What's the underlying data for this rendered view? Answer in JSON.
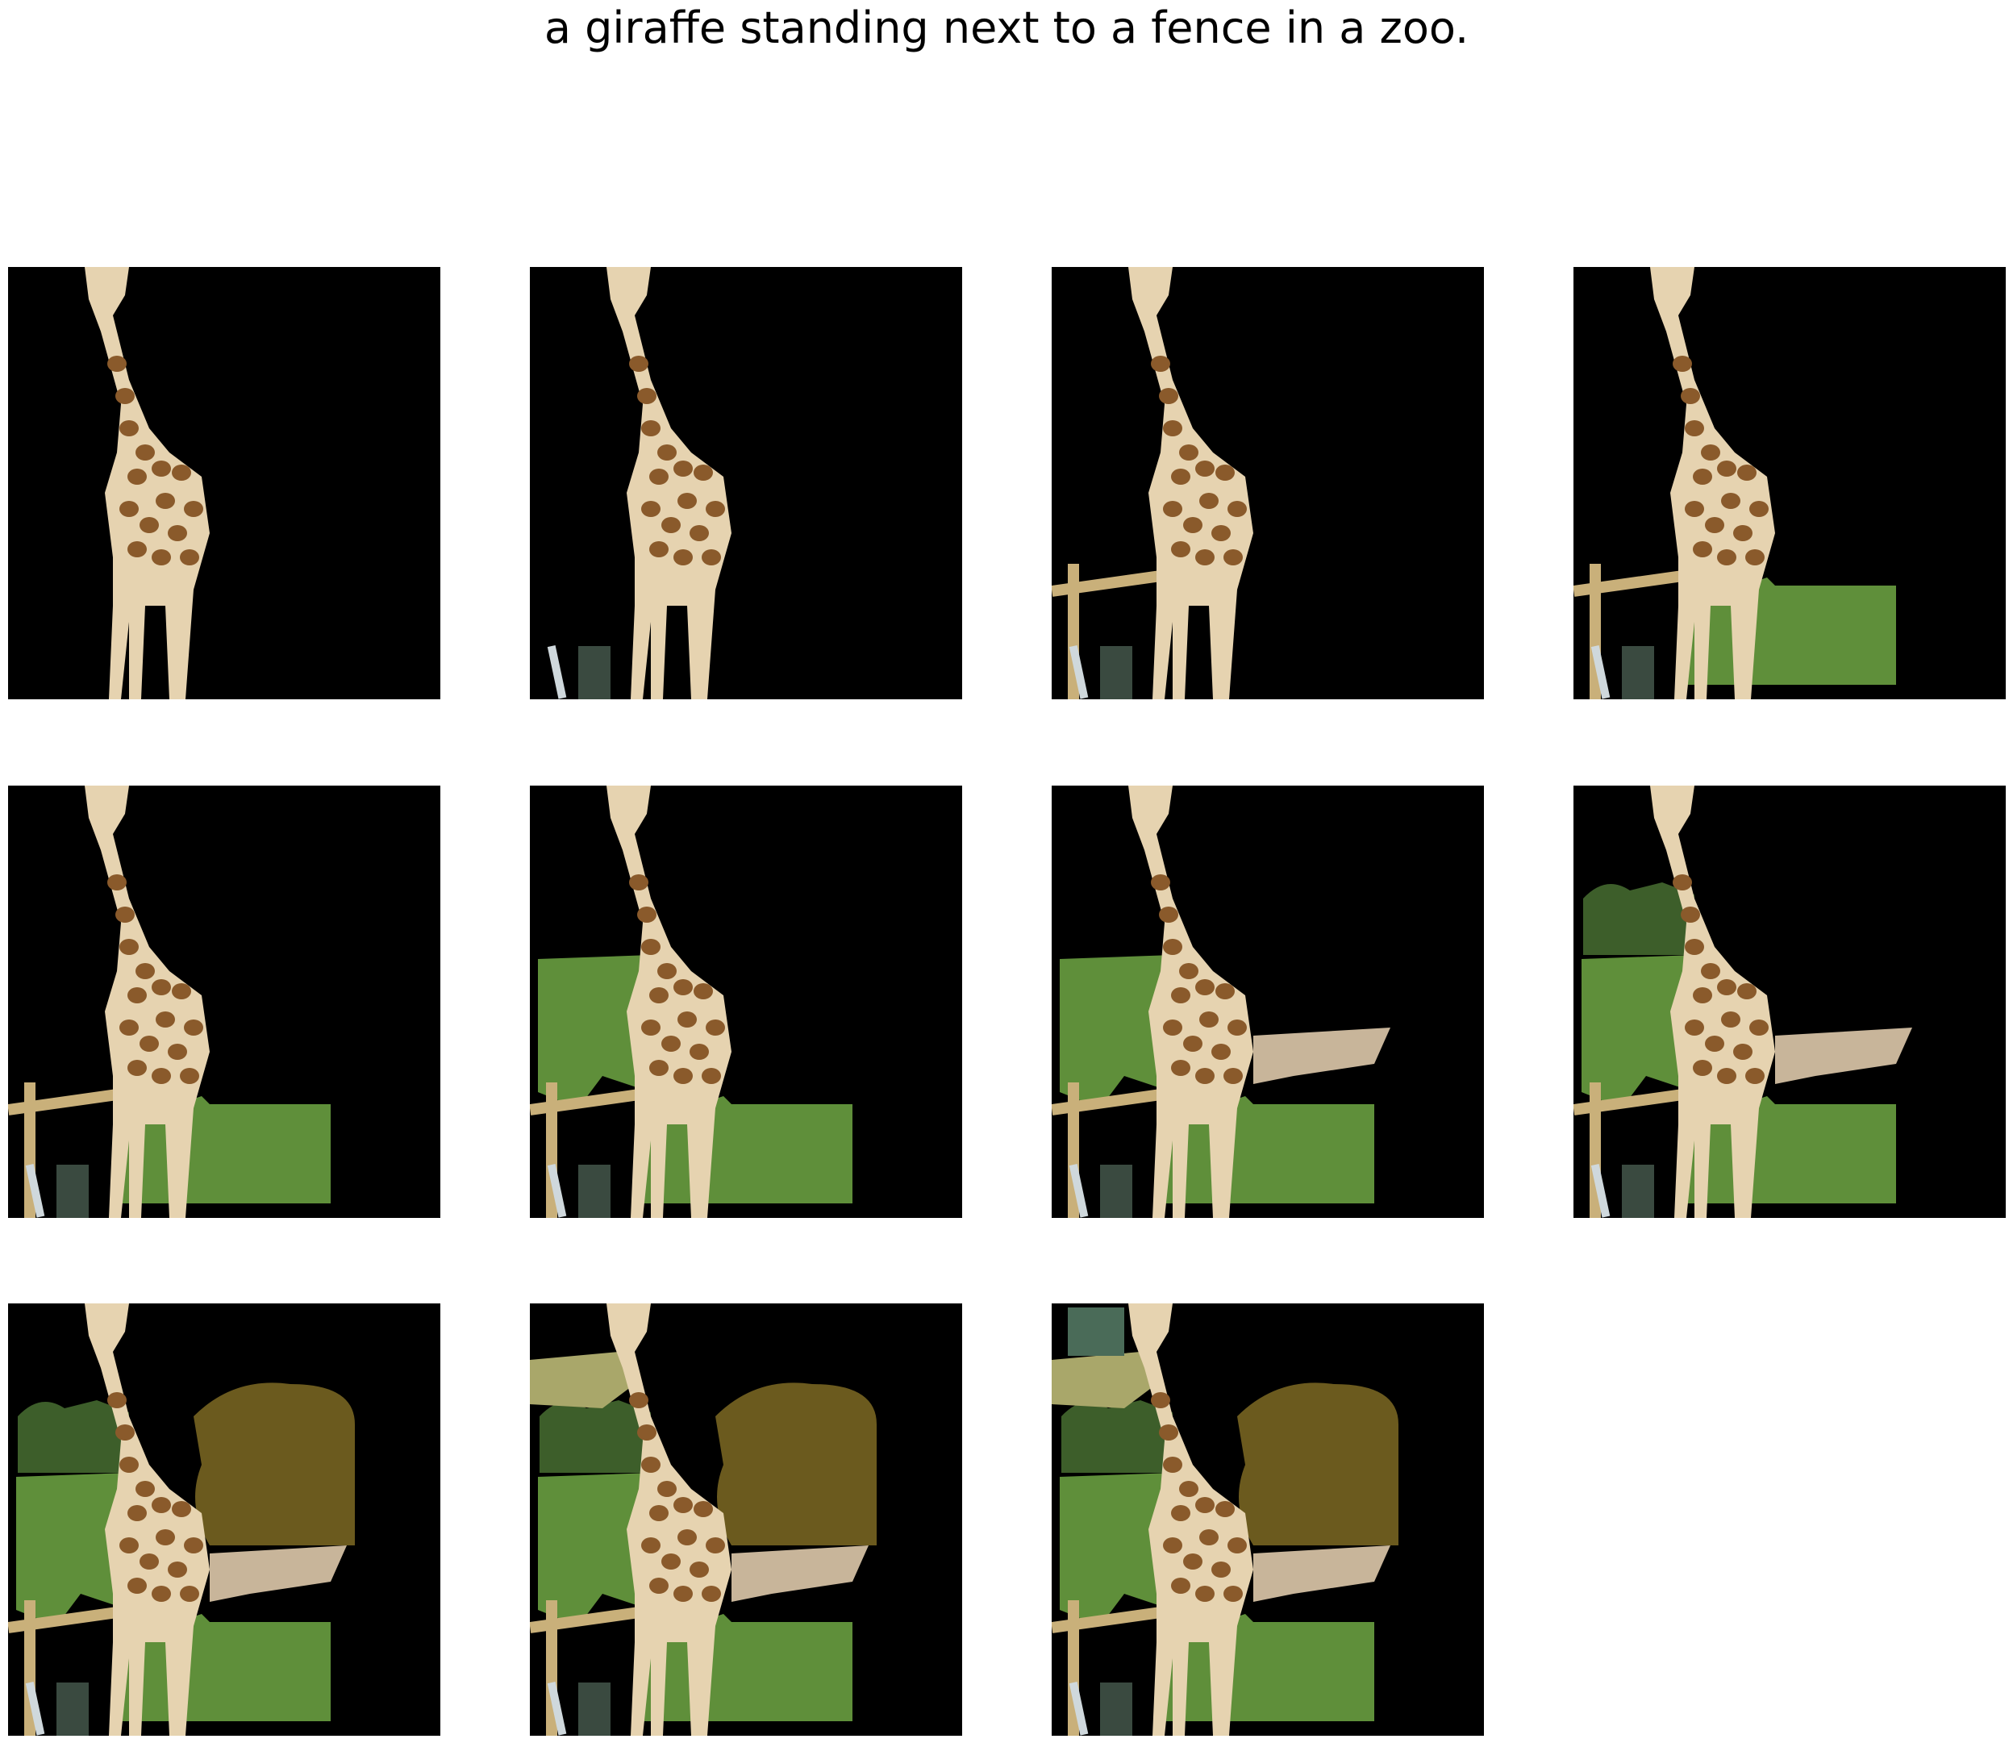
{
  "caption": "a giraffe standing next to a fence in a zoo.",
  "panels": [
    {
      "layers": [
        "giraffe"
      ]
    },
    {
      "layers": [
        "giraffe",
        "post"
      ]
    },
    {
      "layers": [
        "giraffe",
        "post",
        "fence"
      ]
    },
    {
      "layers": [
        "giraffe",
        "post",
        "fence",
        "grass_low"
      ]
    },
    {
      "layers": [
        "giraffe",
        "post",
        "fence",
        "grass_low"
      ]
    },
    {
      "layers": [
        "giraffe",
        "post",
        "fence",
        "grass_low",
        "grass_left"
      ]
    },
    {
      "layers": [
        "giraffe",
        "post",
        "fence",
        "grass_low",
        "grass_left",
        "dirt"
      ]
    },
    {
      "layers": [
        "giraffe",
        "post",
        "fence",
        "grass_low",
        "grass_left",
        "dirt",
        "trees_left"
      ]
    },
    {
      "layers": [
        "giraffe",
        "post",
        "fence",
        "grass_low",
        "grass_left",
        "dirt",
        "trees_left",
        "bush"
      ]
    },
    {
      "layers": [
        "giraffe",
        "post",
        "fence",
        "grass_low",
        "grass_left",
        "dirt",
        "trees_left",
        "bush",
        "top_strip"
      ]
    },
    {
      "layers": [
        "giraffe",
        "post",
        "fence",
        "grass_low",
        "grass_left",
        "dirt",
        "trees_left",
        "bush",
        "top_strip",
        "corner_patch"
      ]
    }
  ],
  "colors": {
    "background": "#000000",
    "giraffe_light": "#e6d3b0",
    "giraffe_spot": "#8a5a2b",
    "grass": "#5f8f3a",
    "grass_dark": "#3d5e2a",
    "dirt": "#c8b59a",
    "bush": "#6b5a1e",
    "fence": "#c9b07a",
    "post": "#3a4a40"
  }
}
